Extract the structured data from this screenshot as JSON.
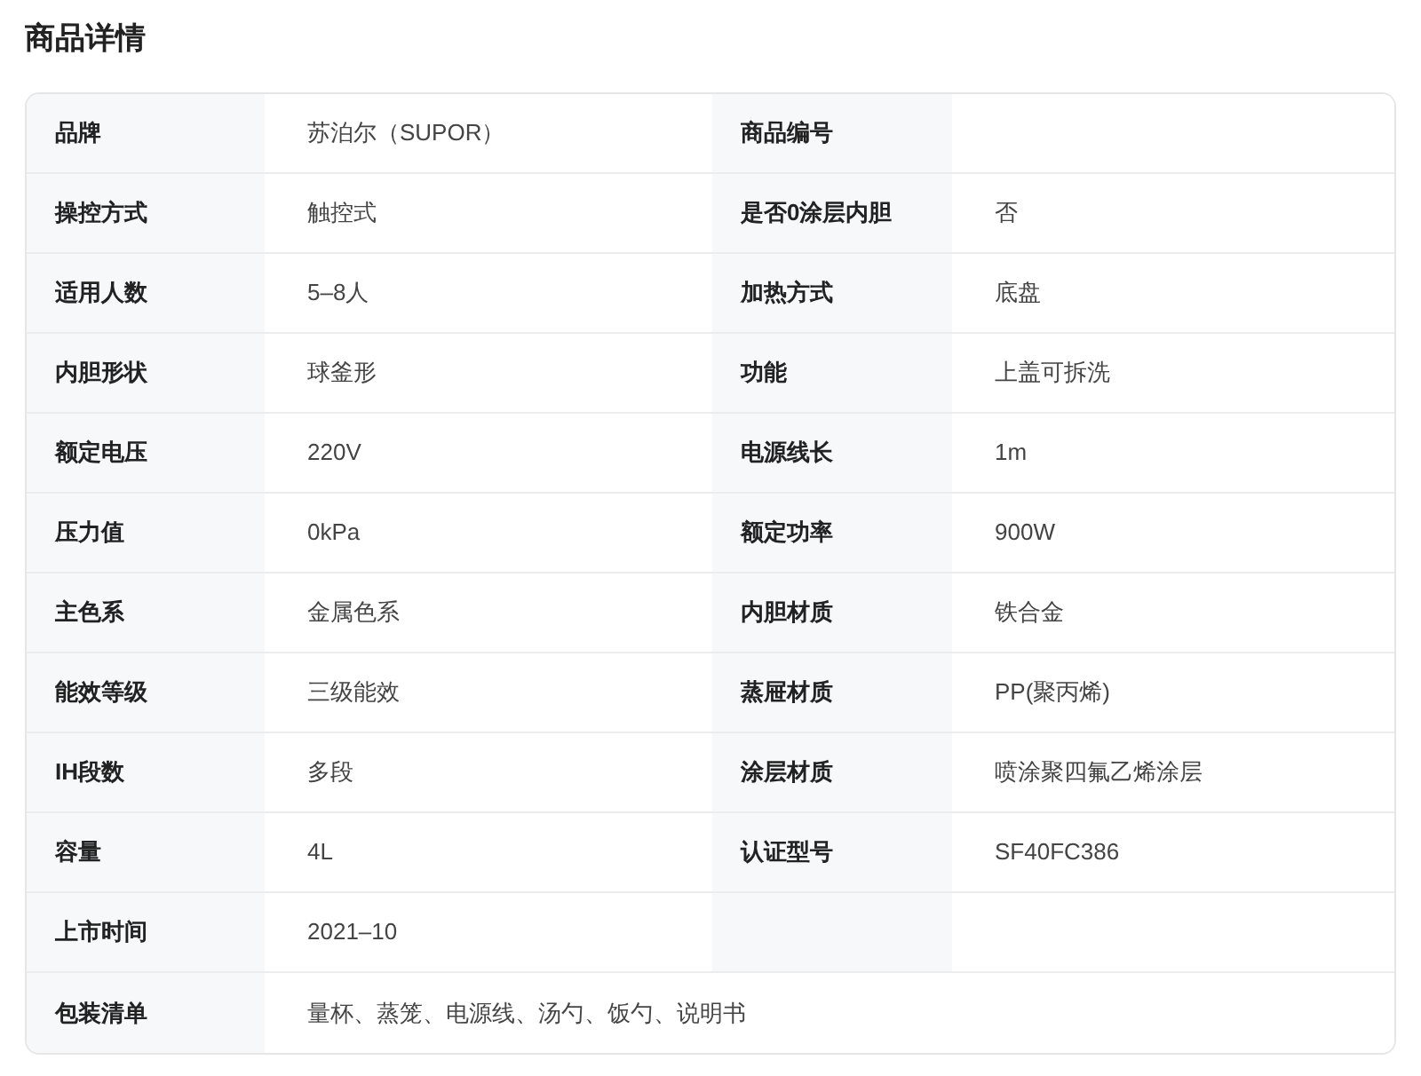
{
  "title": "商品详情",
  "rows": [
    {
      "kind": "pair",
      "cells": [
        {
          "label": "品牌",
          "value": "苏泊尔（SUPOR）"
        },
        {
          "label": "商品编号"
        }
      ]
    },
    {
      "kind": "pair",
      "cells": [
        {
          "label": "操控方式",
          "value": "触控式"
        },
        {
          "label": "是否0涂层内胆",
          "value": "否"
        }
      ]
    },
    {
      "kind": "pair",
      "cells": [
        {
          "label": "适用人数",
          "value": "5–8人"
        },
        {
          "label": "加热方式",
          "value": "底盘"
        }
      ]
    },
    {
      "kind": "pair",
      "cells": [
        {
          "label": "内胆形状",
          "value": "球釜形"
        },
        {
          "label": "功能",
          "value": "上盖可拆洗"
        }
      ]
    },
    {
      "kind": "pair",
      "cells": [
        {
          "label": "额定电压",
          "value": "220V"
        },
        {
          "label": "电源线长",
          "value": "1m"
        }
      ]
    },
    {
      "kind": "pair",
      "cells": [
        {
          "label": "压力值",
          "value": "0kPa"
        },
        {
          "label": "额定功率",
          "value": "900W"
        }
      ]
    },
    {
      "kind": "pair",
      "cells": [
        {
          "label": "主色系",
          "value": "金属色系"
        },
        {
          "label": "内胆材质",
          "value": "铁合金"
        }
      ]
    },
    {
      "kind": "pair",
      "cells": [
        {
          "label": "能效等级",
          "value": "三级能效"
        },
        {
          "label": "蒸屉材质",
          "value": "PP(聚丙烯)"
        }
      ]
    },
    {
      "kind": "pair",
      "cells": [
        {
          "label": "IH段数",
          "value": "多段"
        },
        {
          "label": "涂层材质",
          "value": "喷涂聚四氟乙烯涂层"
        }
      ]
    },
    {
      "kind": "pair",
      "cells": [
        {
          "label": "容量",
          "value": "4L"
        },
        {
          "label": "认证型号",
          "value": "SF40FC386"
        }
      ]
    },
    {
      "kind": "half",
      "cells": [
        {
          "label": "上市时间",
          "value": "2021–10"
        }
      ]
    },
    {
      "kind": "full",
      "cells": [
        {
          "label": "包装清单",
          "value": "量杯、蒸笼、电源线、汤勺、饭勺、说明书"
        }
      ]
    }
  ]
}
